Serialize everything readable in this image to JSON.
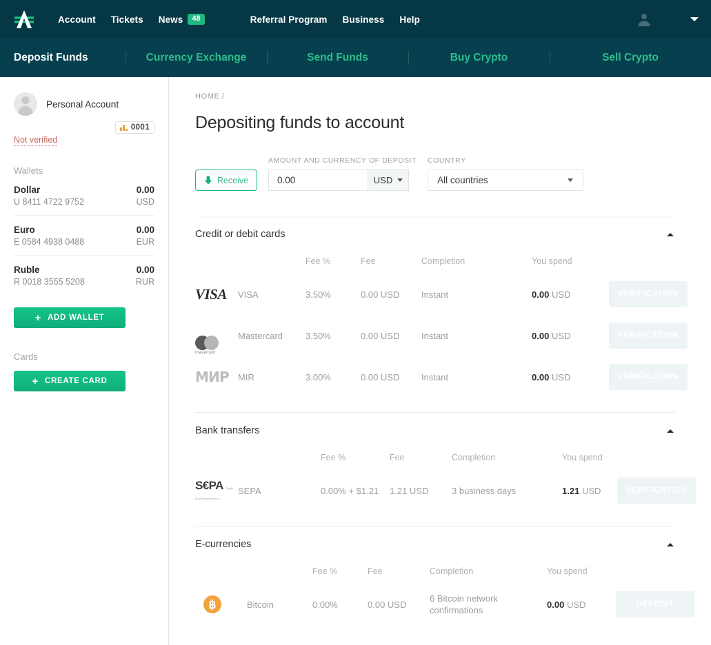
{
  "brand": {
    "accent_green": "#1fb980",
    "header_bg": "#063744",
    "subnav_bg": "#06404e",
    "link_green": "#2dbd8a"
  },
  "header": {
    "logo_name": "advcash-logo",
    "nav_primary": [
      {
        "label": "Account"
      },
      {
        "label": "Tickets"
      },
      {
        "label": "News",
        "badge": "48"
      }
    ],
    "nav_secondary": [
      {
        "label": "Referral Program"
      },
      {
        "label": "Business"
      },
      {
        "label": "Help"
      }
    ],
    "account_menu": {
      "avatar": "user-avatar-icon",
      "caret": "chevron-down-icon"
    }
  },
  "subnav": {
    "items": [
      {
        "label": "Deposit Funds",
        "active": true
      },
      {
        "label": "Currency Exchange",
        "active": false
      },
      {
        "label": "Send Funds",
        "active": false
      },
      {
        "label": "Buy Crypto",
        "active": false
      },
      {
        "label": "Sell Crypto",
        "active": false
      }
    ]
  },
  "sidebar": {
    "account_name": "Personal Account",
    "level_badge": "0001",
    "verification_status": "Not verified",
    "wallets_label": "Wallets",
    "wallets": [
      {
        "name": "Dollar",
        "number": "U 8411 4722 9752",
        "amount": "0.00",
        "currency": "USD"
      },
      {
        "name": "Euro",
        "number": "E 0584 4938 0488",
        "amount": "0.00",
        "currency": "EUR"
      },
      {
        "name": "Ruble",
        "number": "R 0018 3555 5208",
        "amount": "0.00",
        "currency": "RUR"
      }
    ],
    "add_wallet_label": "ADD WALLET",
    "cards_label": "Cards",
    "create_card_label": "CREATE CARD"
  },
  "main": {
    "breadcrumb": "HOME /",
    "title": "Depositing funds to account",
    "form": {
      "receive_label": "Receive",
      "amount_label": "AMOUNT AND CURRENCY OF DEPOSIT",
      "amount_value": "0.00",
      "amount_placeholder": "0.00",
      "currency_value": "USD",
      "country_label": "COUNTRY",
      "country_value": "All countries"
    },
    "columns": {
      "fee_percent": "Fee %",
      "fee": "Fee",
      "completion": "Completion",
      "you_spend": "You spend"
    },
    "sections": [
      {
        "title": "Credit or debit cards",
        "expanded": true,
        "rows": [
          {
            "logo": "visa-logo",
            "name": "VISA",
            "fee_percent": "3.50%",
            "fee_percent_green": false,
            "fee": "0.00 USD",
            "completion": "Instant",
            "spend_amount": "0.00",
            "spend_currency": "USD",
            "action": "VERIFICATION"
          },
          {
            "logo": "mastercard-logo",
            "name": "Mastercard",
            "fee_percent": "3.50%",
            "fee_percent_green": false,
            "fee": "0.00 USD",
            "completion": "Instant",
            "spend_amount": "0.00",
            "spend_currency": "USD",
            "action": "VERIFICATION"
          },
          {
            "logo": "mir-logo",
            "name": "MIR",
            "fee_percent": "3.00%",
            "fee_percent_green": false,
            "fee": "0.00 USD",
            "completion": "Instant",
            "spend_amount": "0.00",
            "spend_currency": "USD",
            "action": "VERIFICATION"
          }
        ]
      },
      {
        "title": "Bank transfers",
        "expanded": true,
        "rows": [
          {
            "logo": "sepa-logo",
            "name": "SEPA",
            "fee_percent": "0.00% + $1.21",
            "fee_percent_green": false,
            "fee": "1.21 USD",
            "completion": "3 business days",
            "spend_amount": "1.21",
            "spend_currency": "USD",
            "action": "VERIFICATION"
          }
        ]
      },
      {
        "title": "E-currencies",
        "expanded": true,
        "rows": [
          {
            "logo": "bitcoin-logo",
            "name": "Bitcoin",
            "fee_percent": "0.00%",
            "fee_percent_green": true,
            "fee": "0.00 USD",
            "completion": "6 Bitcoin network confirmations",
            "spend_amount": "0.00",
            "spend_currency": "USD",
            "action": "DEPOSIT"
          }
        ]
      }
    ]
  }
}
